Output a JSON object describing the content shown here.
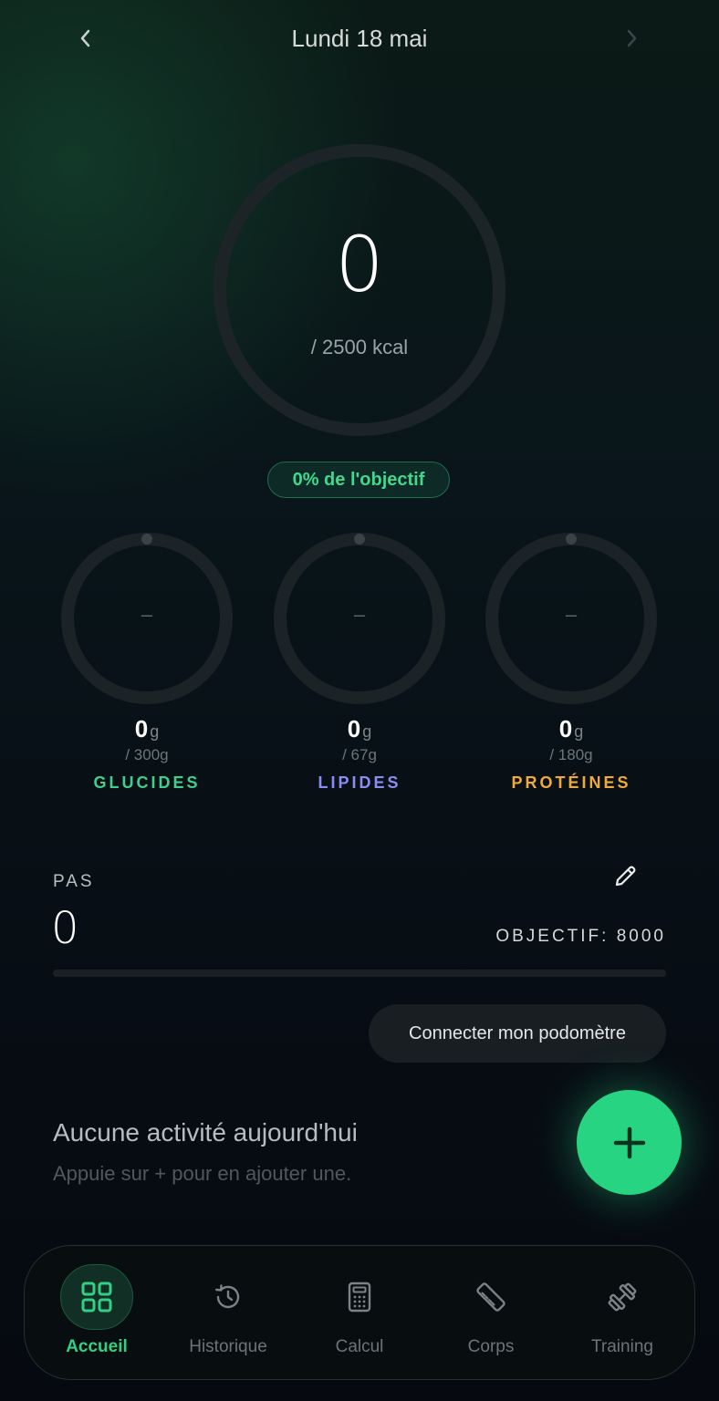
{
  "header": {
    "date": "Lundi 18 mai"
  },
  "calories": {
    "value": "0",
    "goal_label": "/ 2500 kcal",
    "progress": 0,
    "badge": "0% de l'objectif"
  },
  "macros": [
    {
      "name": "GLUCIDES",
      "value": "0",
      "unit": "g",
      "goal": "/ 300g",
      "placeholder": "–",
      "color": "#3ecf8e",
      "progress": 0
    },
    {
      "name": "LIPIDES",
      "value": "0",
      "unit": "g",
      "goal": "/ 67g",
      "placeholder": "–",
      "color": "#8a8cf2",
      "progress": 0
    },
    {
      "name": "PROTÉINES",
      "value": "0",
      "unit": "g",
      "goal": "/ 180g",
      "placeholder": "–",
      "color": "#f0a93b",
      "progress": 0
    }
  ],
  "steps": {
    "label": "PAS",
    "value": "0",
    "goal": "OBJECTIF: 8000",
    "progress": 0,
    "connect_label": "Connecter mon podomètre"
  },
  "activity": {
    "empty_title": "Aucune activité aujourd'hui",
    "empty_subtitle": "Appuie sur + pour en ajouter une."
  },
  "nav": [
    {
      "label": "Accueil",
      "icon": "grid-icon",
      "active": true
    },
    {
      "label": "Historique",
      "icon": "history-icon",
      "active": false
    },
    {
      "label": "Calcul",
      "icon": "calculator-icon",
      "active": false
    },
    {
      "label": "Corps",
      "icon": "ruler-icon",
      "active": false
    },
    {
      "label": "Training",
      "icon": "dumbbell-icon",
      "active": false
    }
  ],
  "colors": {
    "accent": "#27d482",
    "background": "#070d14"
  }
}
